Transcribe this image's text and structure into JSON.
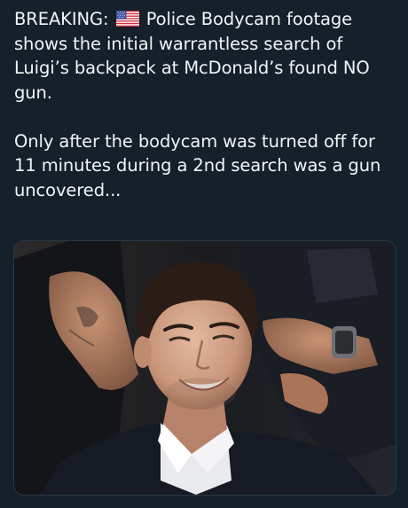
{
  "post": {
    "line_prefix": "BREAKING: ",
    "line_rest": " Police Bodycam footage shows the initial warrantless search of Luigi’s backpack at McDonald’s found NO gun.",
    "paragraph_2": "Only after the bodycam was turned off for 11 minutes during a 2nd search was a gun uncovered...",
    "flag_icon": "us-flag-icon"
  },
  "media": {
    "icon": "photo-image"
  },
  "colors": {
    "background": "#15202b",
    "text": "#f3f5f7",
    "media_border": "#2a3846"
  }
}
